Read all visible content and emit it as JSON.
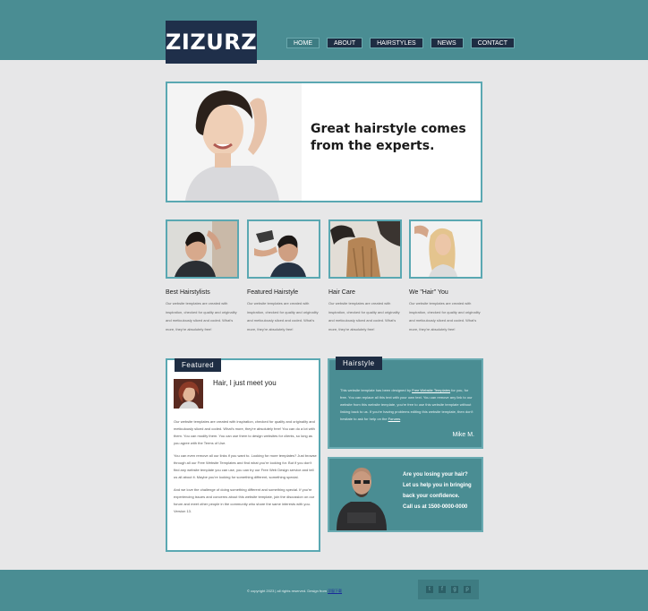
{
  "brand": {
    "logo": "ZIZURZ"
  },
  "nav": {
    "items": [
      "HOME",
      "ABOUT",
      "HAIRSTYLES",
      "NEWS",
      "CONTACT"
    ]
  },
  "hero": {
    "line1": "Great hairstyle comes",
    "line2": "from the experts."
  },
  "features": [
    {
      "title": "Best Hairstylists",
      "text": "Our website templates are created with inspiration, checked for quality and originality and meticulously sliced and coded. What's more, they're absolutely free!"
    },
    {
      "title": "Featured Hairstyle",
      "text": "Our website templates are created with inspiration, checked for quality and originality and meticulously sliced and coded. What's more, they're absolutely free!"
    },
    {
      "title": "Hair Care",
      "text": "Our website templates are created with inspiration, checked for quality and originality and meticulously sliced and coded. What's more, they're absolutely free!"
    },
    {
      "title": "We \"Hair\" You",
      "text": "Our website templates are created with inspiration, checked for quality and originality and meticulously sliced and coded. What's more, they're absolutely free!"
    }
  ],
  "featured": {
    "label": "Featured",
    "heading": "Hair, I just meet you",
    "paragraphs": [
      "Our website templates are created with inspiration, checked for quality and originality and meticulously sliced and coded. What's more, they're absolutely free! You can do a lot with them. You can modify them. You can use them to design websites for clients, so long as you agree with the Terms of Use.",
      "You can even remove all our links if you want to. Looking for more templates? Just browse through all our Free Website Templates and find what you're looking for. But if you don't find any website template you can use, you can try our Free Web Design service and tell us all about it. Maybe you're looking for something different, something special.",
      "And we love the challenge of doing something different and something special. If you're experiencing issues and concerns about this website template, join the discussion on our forum and meet other people in the community who share the same interests with you. Version 13."
    ]
  },
  "hairstyle": {
    "label": "Hairstyle",
    "text_before": "This website template has been designed by",
    "link1": "Free Website Templates",
    "text_after": "for you, for free. You can replace all this text with your own text. You can remove any link to our website from this website template, you're free to use this website template without linking back to us. If you're having problems editing this website template, then don't hesitate to ask for help on the",
    "link2": "Forums",
    "signature": "Mike M."
  },
  "promo": {
    "line1": "Are you losing your hair?",
    "line2": "Let us help you in bringing",
    "line3": "back your confidence.",
    "line4": "Call us at 1500-0000-0000"
  },
  "footer": {
    "copyright": "© copyright 2023 | all rights reserved.  Design from",
    "credit": "浮窗下载"
  },
  "social": [
    "twitter-icon",
    "facebook-icon",
    "googleplus-icon",
    "pinterest-icon"
  ],
  "colors": {
    "teal": "#4a8d93",
    "navy": "#1e2d43",
    "border": "#5aa8b2",
    "background": "#e7e7e8"
  }
}
